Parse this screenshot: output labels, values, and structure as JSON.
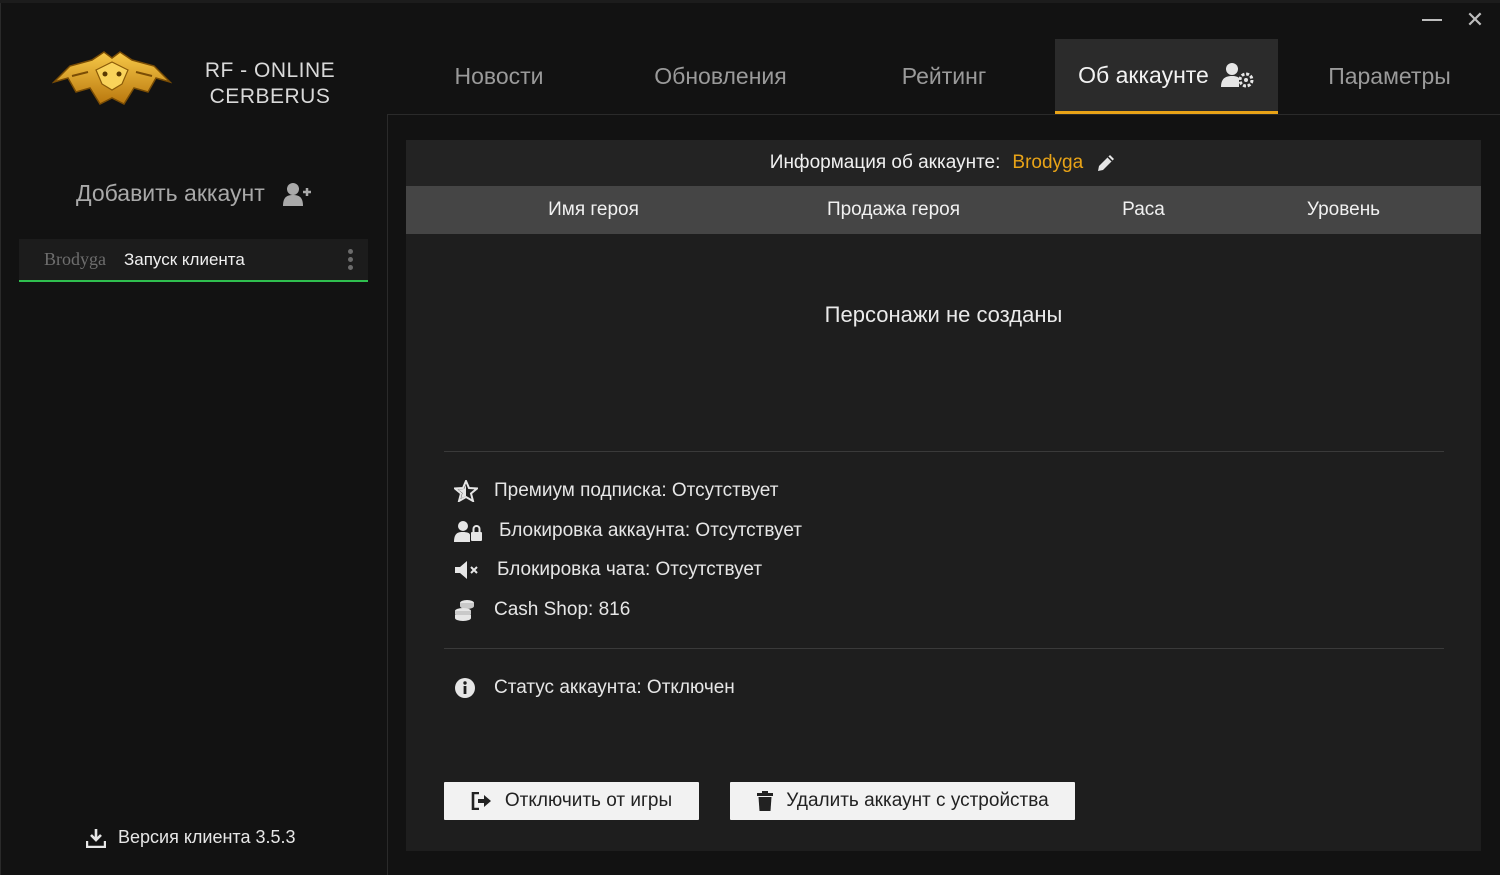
{
  "window": {
    "minimize_icon": "minimize-icon",
    "close_icon": "close-icon",
    "close_glyph": "✕"
  },
  "logo": {
    "line1": "RF - ONLINE",
    "line2": "CERBERUS",
    "accent": "#e8a317"
  },
  "tabs": [
    {
      "label": "Новости",
      "active": false
    },
    {
      "label": "Обновления",
      "active": false
    },
    {
      "label": "Рейтинг",
      "active": false
    },
    {
      "label": "Об аккаунте",
      "active": true,
      "icon": "user-gear-icon"
    },
    {
      "label": "Параметры",
      "active": false
    }
  ],
  "sidebar": {
    "add_account_label": "Добавить аккаунт",
    "add_account_icon": "user-plus-icon",
    "accounts": [
      {
        "name": "Brodyga",
        "action": "Запуск клиента",
        "selected": true,
        "status_color": "#2fbf4f"
      }
    ],
    "version_label": "Версия клиента 3.5.3",
    "version_icon": "download-icon"
  },
  "account": {
    "header_label": "Информация об аккаунте:",
    "username": "Brodyga",
    "edit_icon": "pencil-icon",
    "table_headers": [
      "Имя героя",
      "Продажа героя",
      "Раса",
      "Уровень"
    ],
    "empty_message": "Персонажи не созданы",
    "info": [
      {
        "icon": "star-icon",
        "text": "Премиум подписка: Отсутствует"
      },
      {
        "icon": "user-lock-icon",
        "text": "Блокировка аккаунта: Отсутствует"
      },
      {
        "icon": "volume-mute-icon",
        "text": "Блокировка чата: Отсутствует"
      },
      {
        "icon": "coins-icon",
        "text": "Cash Shop: 816"
      }
    ],
    "status": {
      "icon": "info-icon",
      "text": "Статус аккаунта: Отключен"
    },
    "buttons": {
      "disconnect_label": "Отключить от игры",
      "disconnect_icon": "sign-out-icon",
      "delete_label": "Удалить аккаунт с устройства",
      "delete_icon": "trash-icon"
    }
  }
}
